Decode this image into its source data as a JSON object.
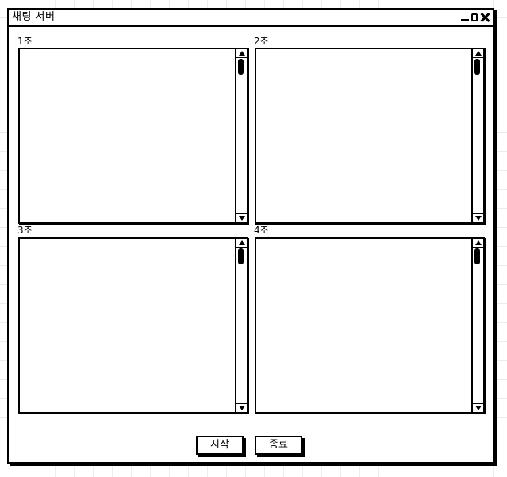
{
  "window": {
    "title": "채팅 서버"
  },
  "groups": [
    {
      "label": "1조",
      "text": ""
    },
    {
      "label": "2조",
      "text": ""
    },
    {
      "label": "3조",
      "text": ""
    },
    {
      "label": "4조",
      "text": ""
    }
  ],
  "buttons": {
    "start_label": "시작",
    "stop_label": "종료"
  },
  "icons": {
    "minimize": "minimize-icon",
    "maximize": "maximize-icon",
    "close": "close-icon",
    "scroll_up": "scroll-up-arrow-icon",
    "scroll_down": "scroll-down-arrow-icon"
  }
}
